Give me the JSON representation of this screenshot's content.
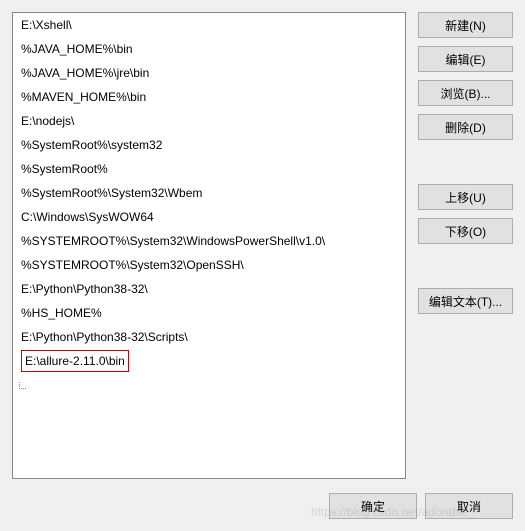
{
  "list": {
    "items": [
      "E:\\Xshell\\",
      "%JAVA_HOME%\\bin",
      "%JAVA_HOME%\\jre\\bin",
      "%MAVEN_HOME%\\bin",
      "E:\\nodejs\\",
      "%SystemRoot%\\system32",
      "%SystemRoot%",
      "%SystemRoot%\\System32\\Wbem",
      "C:\\Windows\\SysWOW64",
      "%SYSTEMROOT%\\System32\\WindowsPowerShell\\v1.0\\",
      "%SYSTEMROOT%\\System32\\OpenSSH\\",
      "E:\\Python\\Python38-32\\",
      "%HS_HOME%",
      "E:\\Python\\Python38-32\\Scripts\\",
      "E:\\allure-2.11.0\\bin"
    ],
    "highlighted_index": 14
  },
  "buttons": {
    "new": "新建(N)",
    "edit": "编辑(E)",
    "browse": "浏览(B)...",
    "delete": "删除(D)",
    "move_up": "上移(U)",
    "move_down": "下移(O)",
    "edit_text": "编辑文本(T)...",
    "ok": "确定",
    "cancel": "取消"
  },
  "watermark": "https://blog.csdn.net/adorable_"
}
